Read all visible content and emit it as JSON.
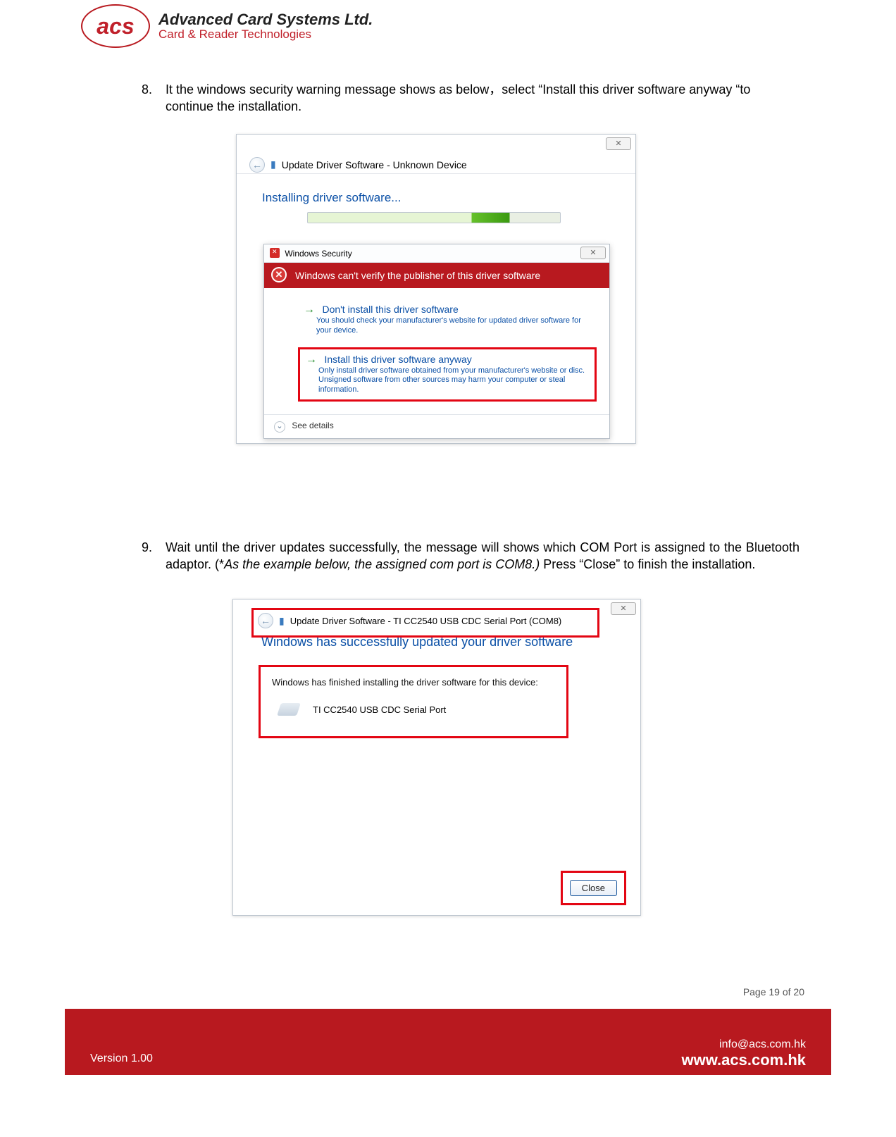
{
  "company": {
    "logo_text": "acs",
    "name": "Advanced Card Systems Ltd.",
    "tagline": "Card & Reader Technologies"
  },
  "step8": {
    "number": "8.",
    "text_part1": "It the windows security warning message shows as below，select “Install this driver software anyway “to continue the installation."
  },
  "step9": {
    "number": "9.",
    "text_a": "Wait until the driver updates successfully, the message will shows which COM Port is assigned to the Bluetooth adaptor. (*",
    "text_italic": "As the example below, the assigned com port is COM8.)",
    "text_b": " Press “Close” to finish the installation."
  },
  "shot1": {
    "outer_title": "Update Driver Software - Unknown Device",
    "installing": "Installing driver software...",
    "sec_title": "Windows Security",
    "banner": "Windows can't verify the publisher of this driver software",
    "opt1_title": "Don't install this driver software",
    "opt1_desc": "You should check your manufacturer's website for updated driver software for your device.",
    "opt2_title": "Install this driver software anyway",
    "opt2_desc": "Only install driver software obtained from your manufacturer's website or disc. Unsigned software from other sources may harm your computer or steal information.",
    "see_details": "See details",
    "close_glyph": "✕"
  },
  "shot2": {
    "outer_title": "Update Driver Software - TI CC2540 USB CDC Serial Port (COM8)",
    "success": "Windows has successfully updated your driver software",
    "finished": "Windows has finished installing the driver software for this device:",
    "device_name": "TI CC2540 USB CDC Serial Port",
    "close_label": "Close",
    "close_glyph": "✕"
  },
  "footer": {
    "page": "Page 19 of 20",
    "version": "Version 1.00",
    "email": "info@acs.com.hk",
    "site": "www.acs.com.hk"
  }
}
